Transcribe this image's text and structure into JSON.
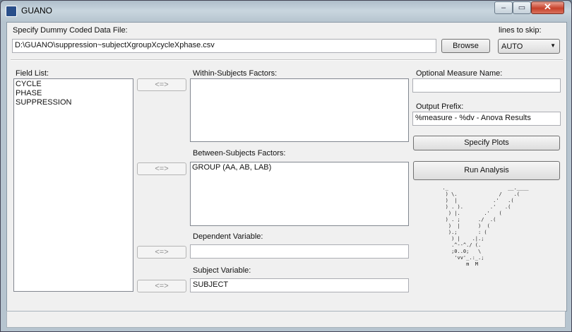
{
  "window": {
    "title": "GUANO",
    "controls": {
      "minimize": "–",
      "maximize": "▭",
      "close": "✕"
    }
  },
  "file": {
    "label": "Specify Dummy Coded Data File:",
    "value": "D:\\GUANO\\suppression~subjectXgroupXcycleXphase.csv",
    "browse_label": "Browse"
  },
  "skip": {
    "label": "lines to skip:",
    "value": "AUTO"
  },
  "field_list": {
    "label": "Field List:",
    "items": [
      "CYCLE",
      "PHASE",
      "SUPPRESSION"
    ]
  },
  "within": {
    "label": "Within-Subjects Factors:",
    "items": [],
    "move_label": "<=>"
  },
  "between": {
    "label": "Between-Subjects Factors:",
    "items": [
      "GROUP (AA, AB, LAB)"
    ],
    "move_label": "<=>"
  },
  "dependent": {
    "label": "Dependent Variable:",
    "value": "",
    "move_label": "<=>"
  },
  "subject": {
    "label": "Subject Variable:",
    "value": "SUBJECT",
    "move_label": "<=>"
  },
  "measure": {
    "label": "Optional Measure Name:",
    "value": ""
  },
  "prefix": {
    "label": "Output Prefix:",
    "value": "%measure - %dv - Anova Results"
  },
  "actions": {
    "plots_label": "Specify Plots",
    "run_label": "Run Analysis"
  },
  "logo_art": "  ._                    __.____\n   ) \\.              /    .(\n   )  |            .'   .(\n   ) . ).         .'   .(\n    ) |.        .'   (\n   ) . ;      ./  .(\n    )  |      )  (\n    ).;       : (\n     ) |    .|.;\n     .^--^./ (.\n     ;0..0;   \\\n      'vv'_.:_.;\n          m  M"
}
